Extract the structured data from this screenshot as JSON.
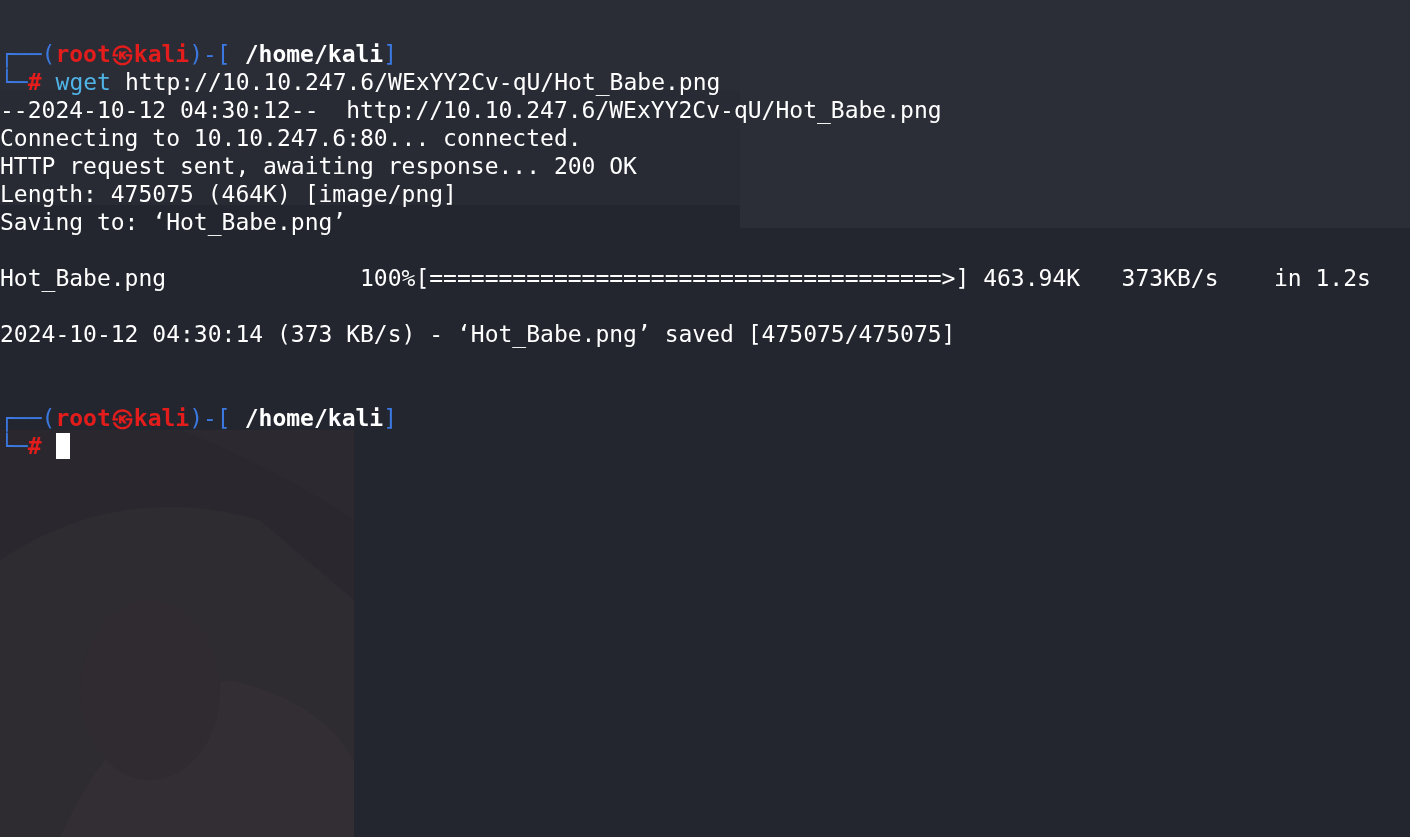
{
  "terminal": {
    "lines": [
      {
        "kind": "prompt",
        "corner_top": "┌──(",
        "user": "root㉿kali",
        "separator": ")-[",
        "path": "/home/kali",
        "close": "]",
        "corner_bottom": "└─",
        "sign": "#",
        "command": "wget",
        "args": "http://10.10.247.6/WExYY2Cv-qU/Hot_Babe.png",
        "cursor": false
      },
      {
        "kind": "output",
        "text": "--2024-10-12 04:30:12--  http://10.10.247.6/WExYY2Cv-qU/Hot_Babe.png"
      },
      {
        "kind": "output",
        "text": "Connecting to 10.10.247.6:80... connected."
      },
      {
        "kind": "output",
        "text": "HTTP request sent, awaiting response... 200 OK"
      },
      {
        "kind": "output",
        "text": "Length: 475075 (464K) [image/png]"
      },
      {
        "kind": "output",
        "text": "Saving to: ‘Hot_Babe.png’"
      },
      {
        "kind": "blank"
      },
      {
        "kind": "output",
        "text": "Hot_Babe.png              100%[=====================================>] 463.94K   373KB/s    in 1.2s"
      },
      {
        "kind": "blank"
      },
      {
        "kind": "output",
        "text": "2024-10-12 04:30:14 (373 KB/s) - ‘Hot_Babe.png’ saved [475075/475075]"
      },
      {
        "kind": "blank"
      },
      {
        "kind": "blank"
      },
      {
        "kind": "prompt",
        "corner_top": "┌──(",
        "user": "root㉿kali",
        "separator": ")-[",
        "path": "/home/kali",
        "close": "]",
        "corner_bottom": "└─",
        "sign": "#",
        "cursor": true
      }
    ]
  }
}
